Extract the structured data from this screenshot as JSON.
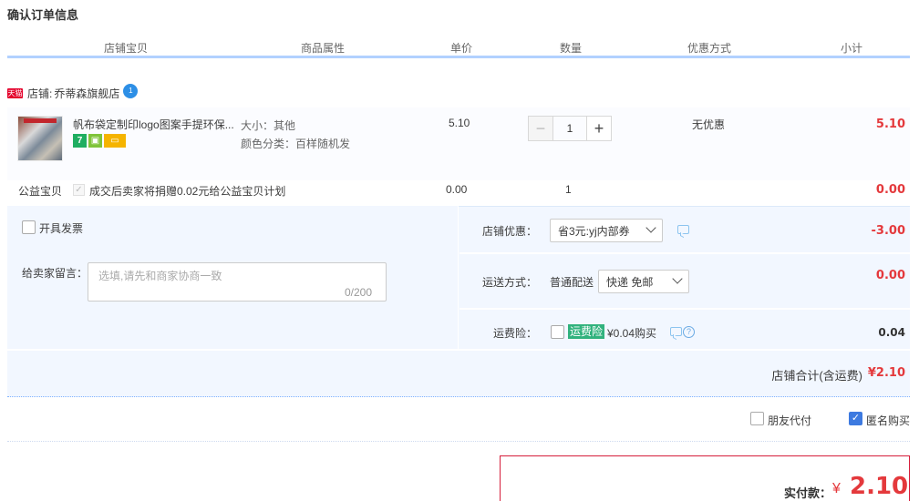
{
  "page_title": "确认订单信息",
  "columns": [
    "店铺宝贝",
    "商品属性",
    "单价",
    "数量",
    "优惠方式",
    "小计"
  ],
  "shop": {
    "tag": "天猫",
    "label": "店铺:",
    "name": "乔蒂森旗舰店",
    "ww_badge": "1"
  },
  "item": {
    "title": "帆布袋定制印logo图案手提环保...",
    "badges": [
      "7",
      "",
      ""
    ],
    "attr_size": "大小：其他",
    "attr_color": "颜色分类：百样随机发",
    "unit_price": "5.10",
    "quantity": "1",
    "qty_minus": "−",
    "qty_plus": "+",
    "discount": "无优惠",
    "subtotal": "5.10"
  },
  "charity": {
    "label": "公益宝贝",
    "check": "✓",
    "text": "成交后卖家将捐赠0.02元给公益宝贝计划",
    "price": "0.00",
    "qty": "1",
    "subtotal": "0.00"
  },
  "invoice": {
    "label": "开具发票"
  },
  "memo": {
    "label": "给卖家留言：",
    "placeholder": "选填,请先和商家协商一致",
    "counter": "0/200"
  },
  "coupon": {
    "label": "店铺优惠：",
    "selected": "省3元:yj内部券",
    "amount": "-3.00"
  },
  "shipping": {
    "label": "运送方式：",
    "type": "普通配送",
    "selected": "快递 免邮",
    "amount": "0.00"
  },
  "insurance": {
    "label": "运费险：",
    "tag": "运费险",
    "price": "¥0.04购买",
    "help": "?",
    "amount": "0.04"
  },
  "shop_total": {
    "label": "店铺合计(含运费)",
    "amount": "¥2.10"
  },
  "options": {
    "friend_pay": "朋友代付",
    "anonymous": "匿名购买",
    "anon_check": "✓"
  },
  "payment": {
    "label": "实付款：",
    "currency": "¥",
    "amount": "2.10"
  }
}
